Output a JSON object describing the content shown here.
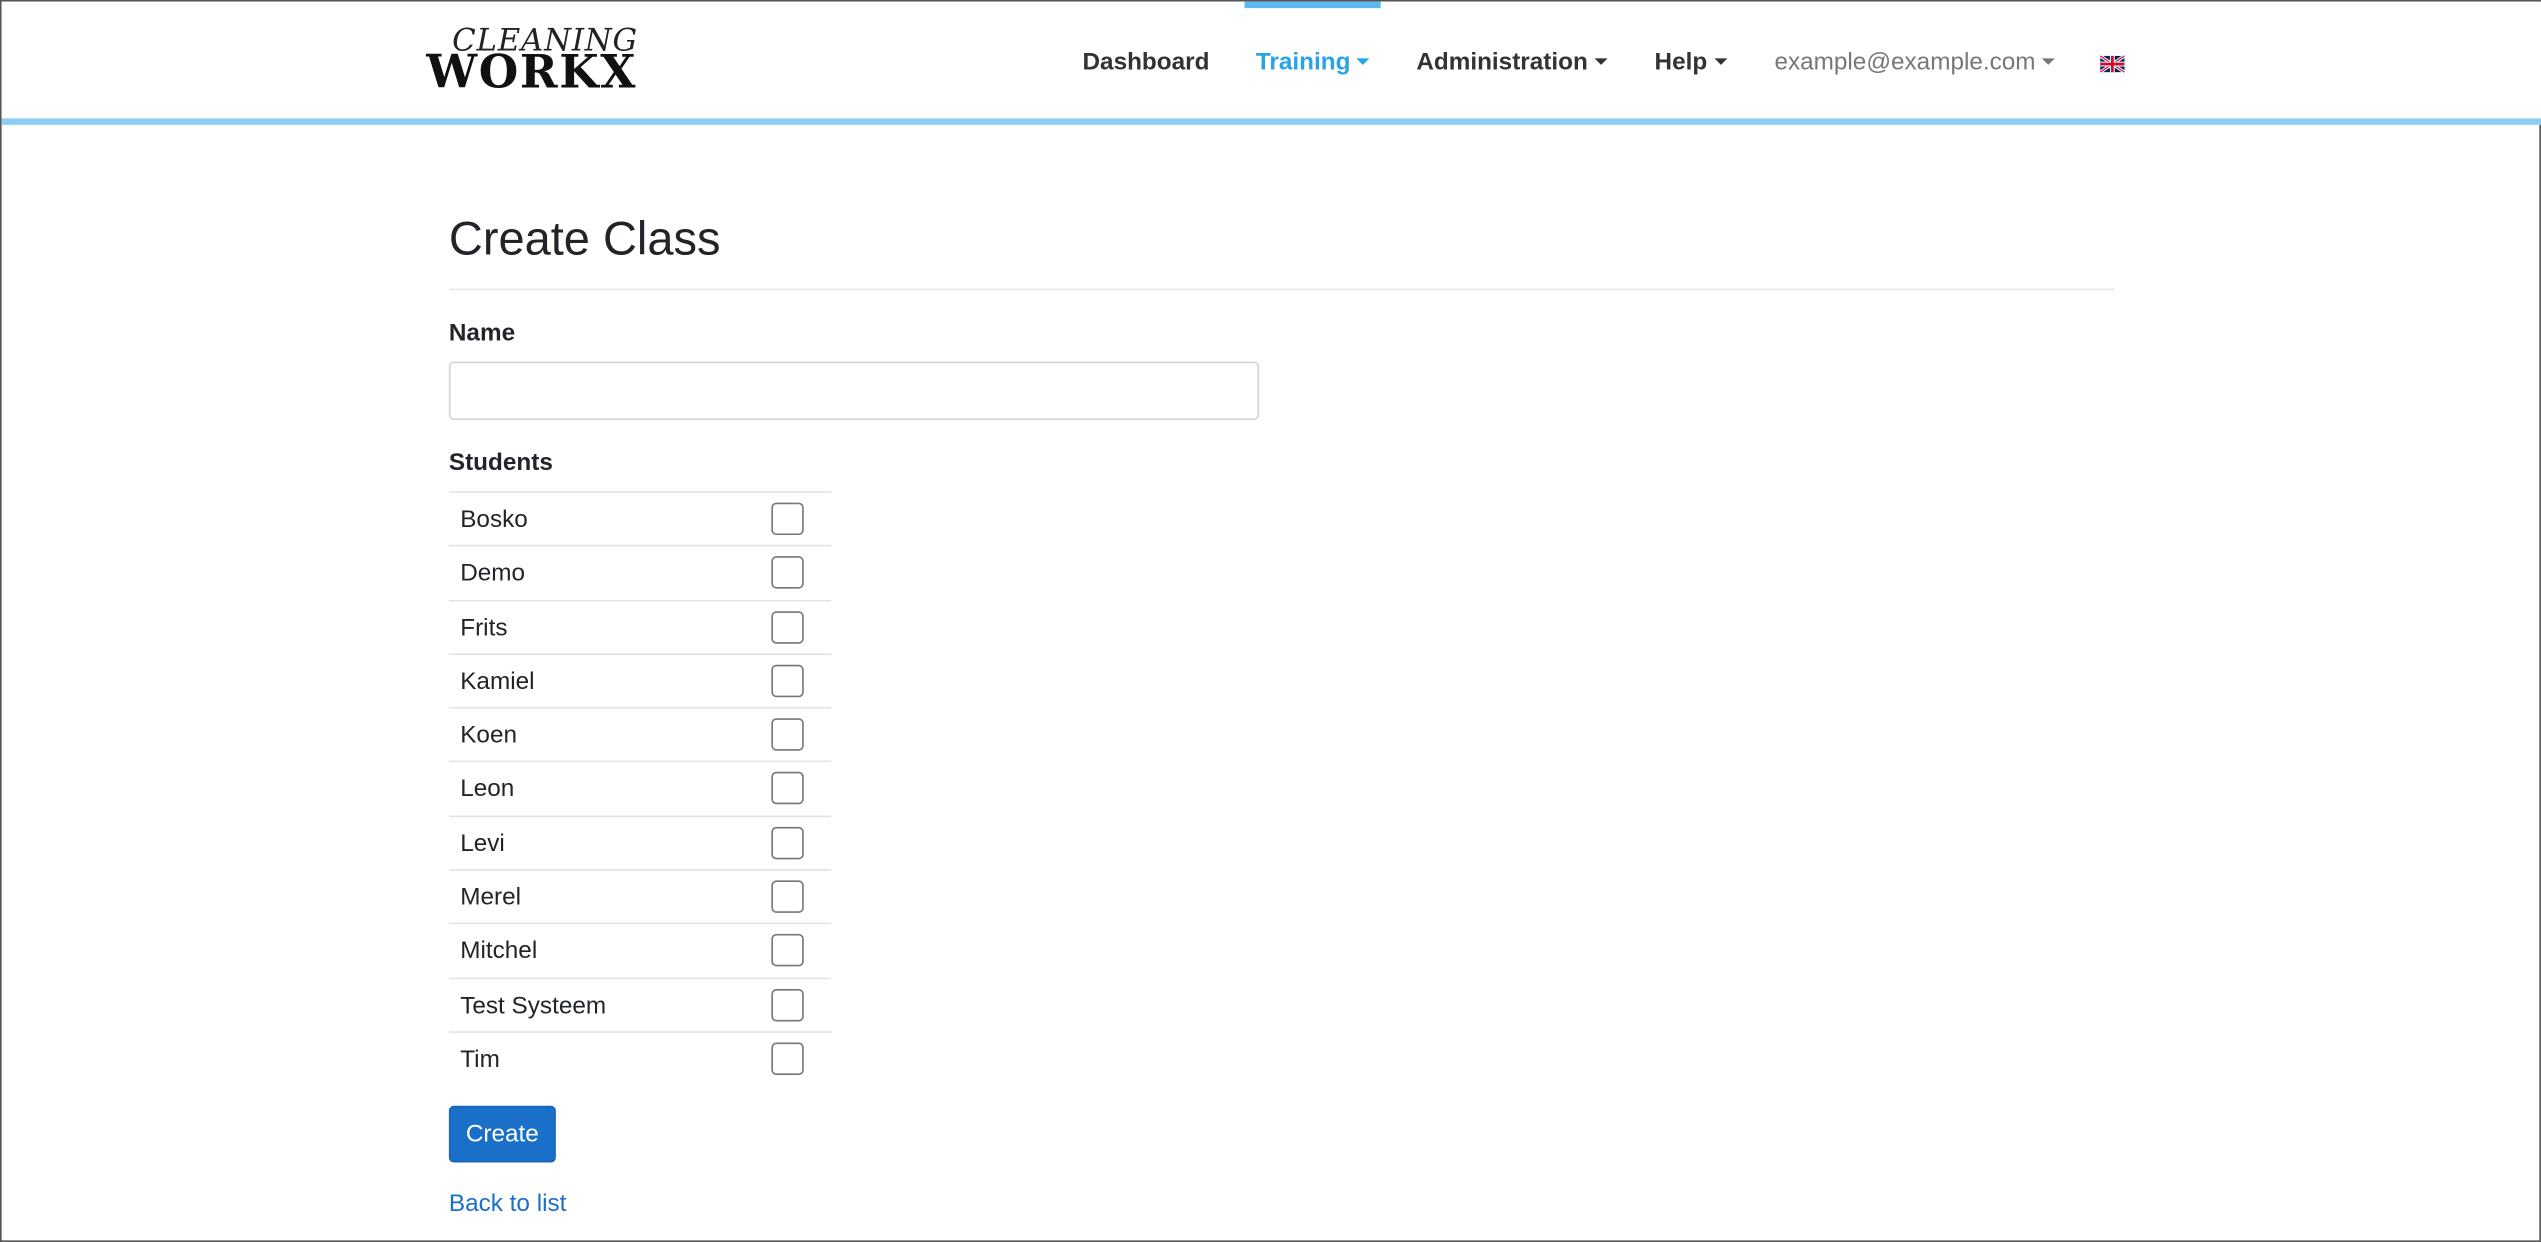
{
  "brand": {
    "line1": "CLEANING",
    "line2": "WORKX"
  },
  "nav": {
    "dashboard": "Dashboard",
    "training": "Training",
    "administration": "Administration",
    "help": "Help",
    "user": "example@example.com"
  },
  "page": {
    "title": "Create Class"
  },
  "form": {
    "name_label": "Name",
    "name_value": "",
    "students_label": "Students",
    "students": [
      {
        "name": "Bosko",
        "checked": false
      },
      {
        "name": "Demo",
        "checked": false
      },
      {
        "name": "Frits",
        "checked": false
      },
      {
        "name": "Kamiel",
        "checked": false
      },
      {
        "name": "Koen",
        "checked": false
      },
      {
        "name": "Leon",
        "checked": false
      },
      {
        "name": "Levi",
        "checked": false
      },
      {
        "name": "Merel",
        "checked": false
      },
      {
        "name": "Mitchel",
        "checked": false
      },
      {
        "name": "Test Systeem",
        "checked": false
      },
      {
        "name": "Tim",
        "checked": false
      }
    ],
    "create_label": "Create",
    "back_label": "Back to list"
  },
  "colors": {
    "accent": "#29a3e6",
    "primary": "#1a6fc9",
    "nav_border": "#8ecdf3"
  },
  "icons": {
    "language": "uk-flag-icon"
  }
}
